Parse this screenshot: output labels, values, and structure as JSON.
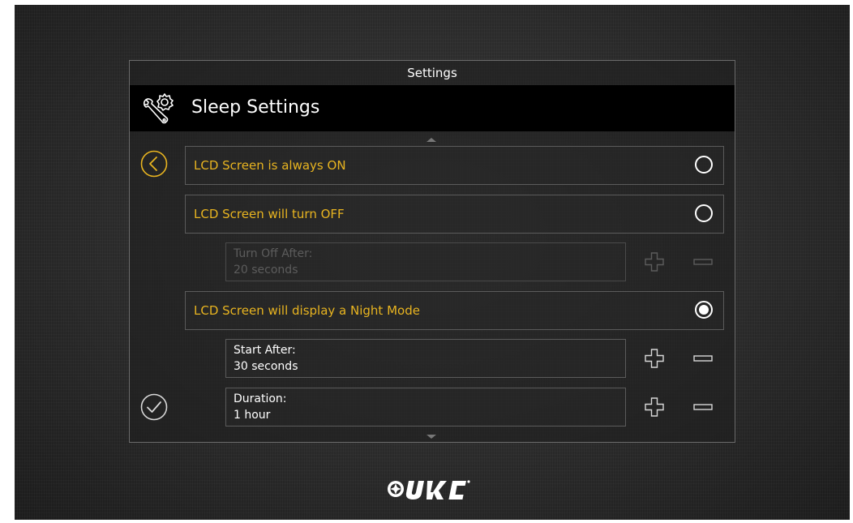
{
  "title_bar": {
    "title": "Settings"
  },
  "header": {
    "title": "Sleep Settings",
    "icon": "wrench-gear-icon"
  },
  "nav": {
    "back_icon": "chevron-left-icon",
    "confirm_icon": "checkmark-icon"
  },
  "options": [
    {
      "label": "LCD Screen is always ON",
      "selected": false
    },
    {
      "label": "LCD Screen will turn OFF",
      "selected": false
    },
    {
      "label": "LCD Screen will display a Night Mode",
      "selected": true
    }
  ],
  "fields": {
    "turn_off_after": {
      "label": "Turn Off After:",
      "value": "20 seconds",
      "enabled": false
    },
    "start_after": {
      "label": "Start After:",
      "value": "30 seconds",
      "enabled": true
    },
    "duration": {
      "label": "Duration:",
      "value": "1 hour",
      "enabled": true
    }
  },
  "colors": {
    "accent": "#e8b420",
    "text": "#ffffff",
    "disabled_text": "#5c5c5c",
    "header_bg": "#000000"
  },
  "brand": {
    "logo": "URC"
  }
}
